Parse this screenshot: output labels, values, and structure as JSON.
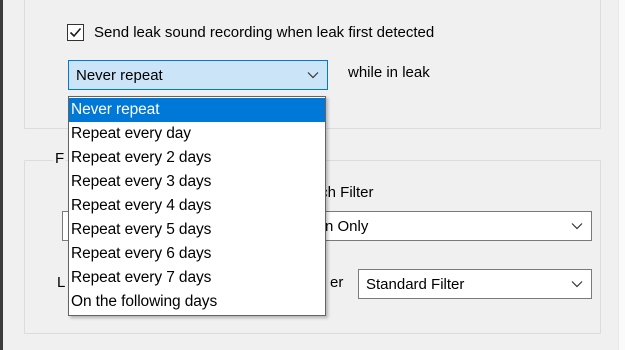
{
  "checkbox": {
    "checked": true,
    "label": "Send leak sound recording when leak first detected"
  },
  "repeat_combo": {
    "selected": "Never repeat",
    "suffix": "while in leak"
  },
  "dropdown": {
    "options": [
      "Never repeat",
      "Repeat every day",
      "Repeat every 2 days",
      "Repeat every 3 days",
      "Repeat every 4 days",
      "Repeat every 5 days",
      "Repeat every 6 days",
      "Repeat every 7 days",
      "On the following days"
    ],
    "highlighted": "Never repeat"
  },
  "filter_section": {
    "partial_group_label": "F",
    "partial_header": "tch Filter",
    "filter1_value": "n Only",
    "partial_row_label": "L",
    "partial_row_label2": "er",
    "filter2_value": "Standard Filter"
  },
  "colors": {
    "accent": "#0078d7",
    "combo_focus_bg": "#cce4f7",
    "window_bg": "#f0f0f0"
  }
}
